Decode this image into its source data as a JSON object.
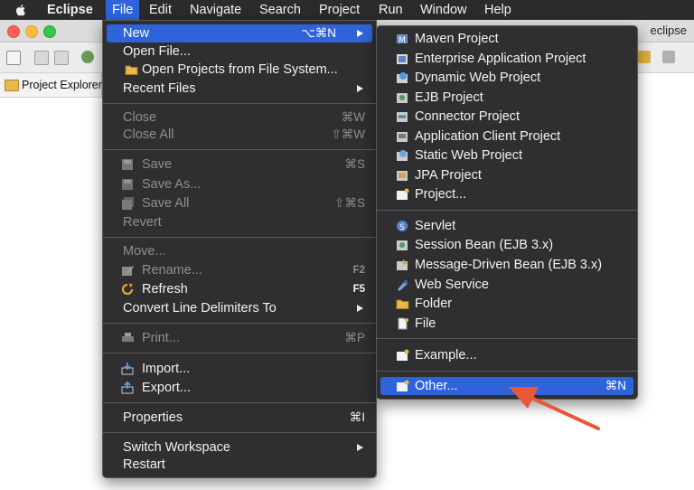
{
  "menubar": {
    "app_name": "Eclipse",
    "items": [
      "File",
      "Edit",
      "Navigate",
      "Search",
      "Project",
      "Run",
      "Window",
      "Help"
    ]
  },
  "window": {
    "title": "eclipse"
  },
  "project_explorer": {
    "label": "Project Explorer"
  },
  "file_menu": {
    "new": {
      "label": "New",
      "shortcut": "⌥⌘N"
    },
    "open_file": {
      "label": "Open File..."
    },
    "open_projects": {
      "label": "Open Projects from File System..."
    },
    "recent_files": {
      "label": "Recent Files"
    },
    "close": {
      "label": "Close",
      "shortcut": "⌘W"
    },
    "close_all": {
      "label": "Close All",
      "shortcut": "⇧⌘W"
    },
    "save": {
      "label": "Save",
      "shortcut": "⌘S"
    },
    "save_as": {
      "label": "Save As..."
    },
    "save_all": {
      "label": "Save All",
      "shortcut": "⇧⌘S"
    },
    "revert": {
      "label": "Revert"
    },
    "move": {
      "label": "Move..."
    },
    "rename": {
      "label": "Rename...",
      "shortcut": "F2"
    },
    "refresh": {
      "label": "Refresh",
      "shortcut": "F5"
    },
    "convert": {
      "label": "Convert Line Delimiters To"
    },
    "print": {
      "label": "Print...",
      "shortcut": "⌘P"
    },
    "import": {
      "label": "Import..."
    },
    "export": {
      "label": "Export..."
    },
    "properties": {
      "label": "Properties",
      "shortcut": "⌘I"
    },
    "switch_workspace": {
      "label": "Switch Workspace"
    },
    "restart": {
      "label": "Restart"
    }
  },
  "new_submenu": {
    "maven_project": {
      "label": "Maven Project"
    },
    "enterprise_app": {
      "label": "Enterprise Application Project"
    },
    "dynamic_web": {
      "label": "Dynamic Web Project"
    },
    "ejb_project": {
      "label": "EJB Project"
    },
    "connector_project": {
      "label": "Connector Project"
    },
    "app_client": {
      "label": "Application Client Project"
    },
    "static_web": {
      "label": "Static Web Project"
    },
    "jpa_project": {
      "label": "JPA Project"
    },
    "project": {
      "label": "Project..."
    },
    "servlet": {
      "label": "Servlet"
    },
    "session_bean": {
      "label": "Session Bean (EJB 3.x)"
    },
    "mdb": {
      "label": "Message-Driven Bean (EJB 3.x)"
    },
    "web_service": {
      "label": "Web Service"
    },
    "folder": {
      "label": "Folder"
    },
    "file": {
      "label": "File"
    },
    "example": {
      "label": "Example..."
    },
    "other": {
      "label": "Other...",
      "shortcut": "⌘N"
    }
  },
  "colors": {
    "highlight": "#2e63d9",
    "menu_bg": "#2f2f31",
    "annotation_arrow": "#e8573a"
  }
}
